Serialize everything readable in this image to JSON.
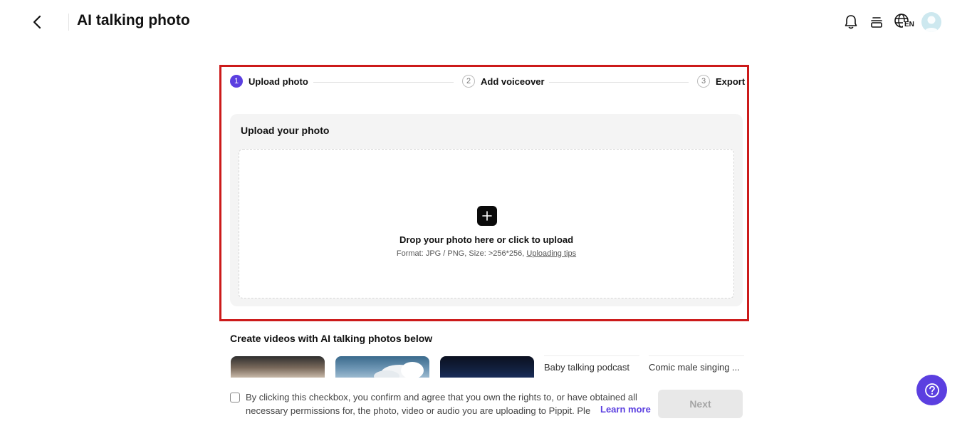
{
  "header": {
    "title": "AI talking photo",
    "back_icon": "chevron-left-icon",
    "icons": [
      "bell-icon",
      "credits-icon",
      "language-icon",
      "avatar"
    ],
    "language_code": "EN"
  },
  "steps": [
    {
      "number": "1",
      "label": "Upload photo",
      "active": true
    },
    {
      "number": "2",
      "label": "Add voiceover",
      "active": false
    },
    {
      "number": "3",
      "label": "Export",
      "active": false
    }
  ],
  "upload": {
    "heading": "Upload your photo",
    "drop_title": "Drop your photo here or click to upload",
    "format_text": "Format: JPG / PNG, Size: >256*256,",
    "tips_link": "Uploading tips"
  },
  "examples": {
    "title": "Create videos with AI talking photos below",
    "cards": [
      {
        "label": "Baby talking podcast"
      },
      {
        "label": "Comic male singing ..."
      }
    ]
  },
  "footer": {
    "consent_text": "By clicking this checkbox, you confirm and agree that you own the rights to, or have obtained all necessary permissions for, the photo, video or audio you are uploading to Pippit. Ple",
    "learn_more": "Learn more",
    "next_label": "Next"
  },
  "colors": {
    "accent": "#5b3fe0",
    "highlight_border": "#cc1a1a",
    "panel_bg": "#f4f4f4"
  }
}
